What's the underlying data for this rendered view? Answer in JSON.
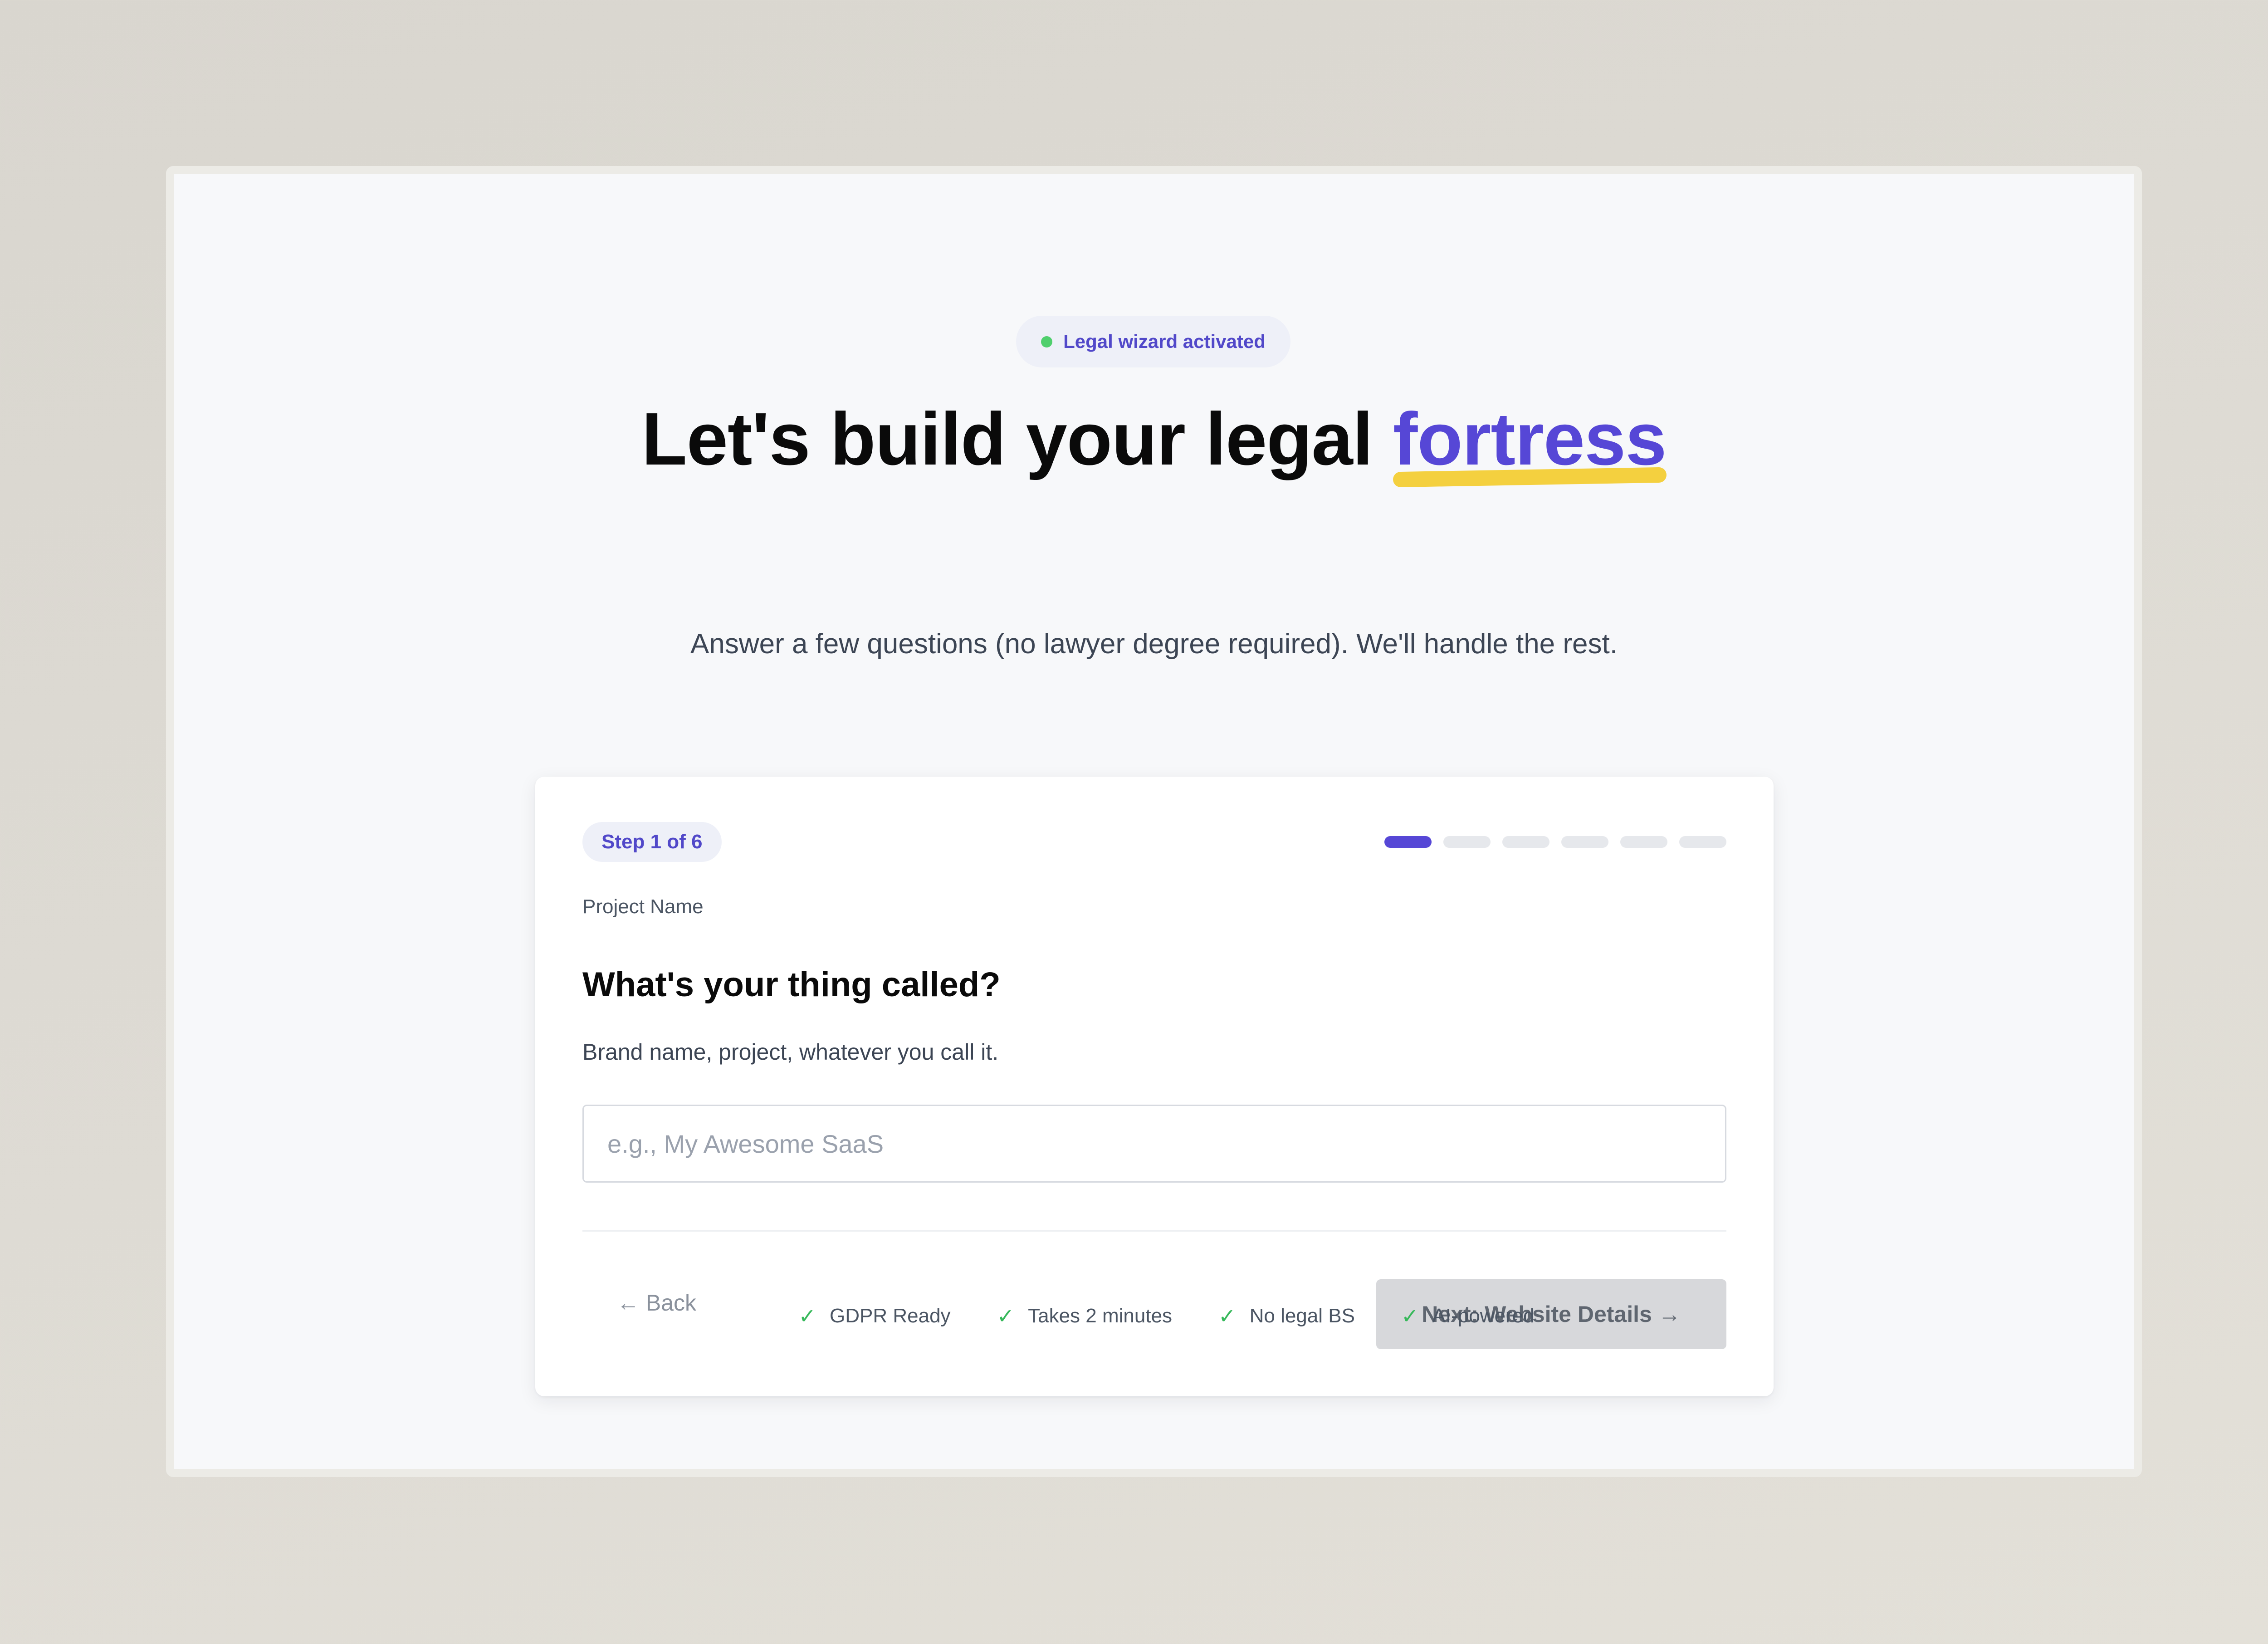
{
  "badge": {
    "text": "Legal wizard activated"
  },
  "hero": {
    "title_prefix": "Let's build your legal ",
    "title_accent": "fortress",
    "subtitle": "Answer a few questions (no lawyer degree required). We'll handle the rest."
  },
  "wizard": {
    "step_label": "Step 1 of 6",
    "total_steps": 6,
    "current_step": 1,
    "section": "Project Name",
    "question": "What's your thing called?",
    "hint": "Brand name, project, whatever you call it.",
    "input": {
      "value": "",
      "placeholder": "e.g., My Awesome SaaS"
    },
    "back_label": "← Back",
    "next_label": "Next: Website Details →"
  },
  "features": [
    {
      "icon": "check-icon",
      "label": "GDPR Ready"
    },
    {
      "icon": "check-icon",
      "label": "Takes 2 minutes"
    },
    {
      "icon": "check-icon",
      "label": "No legal BS"
    },
    {
      "icon": "check-icon",
      "label": "AI-powered"
    }
  ],
  "colors": {
    "accent": "#5647d6",
    "highlight": "#f4d03f",
    "status_green": "#4fcf6d",
    "check_green": "#36b85a"
  }
}
